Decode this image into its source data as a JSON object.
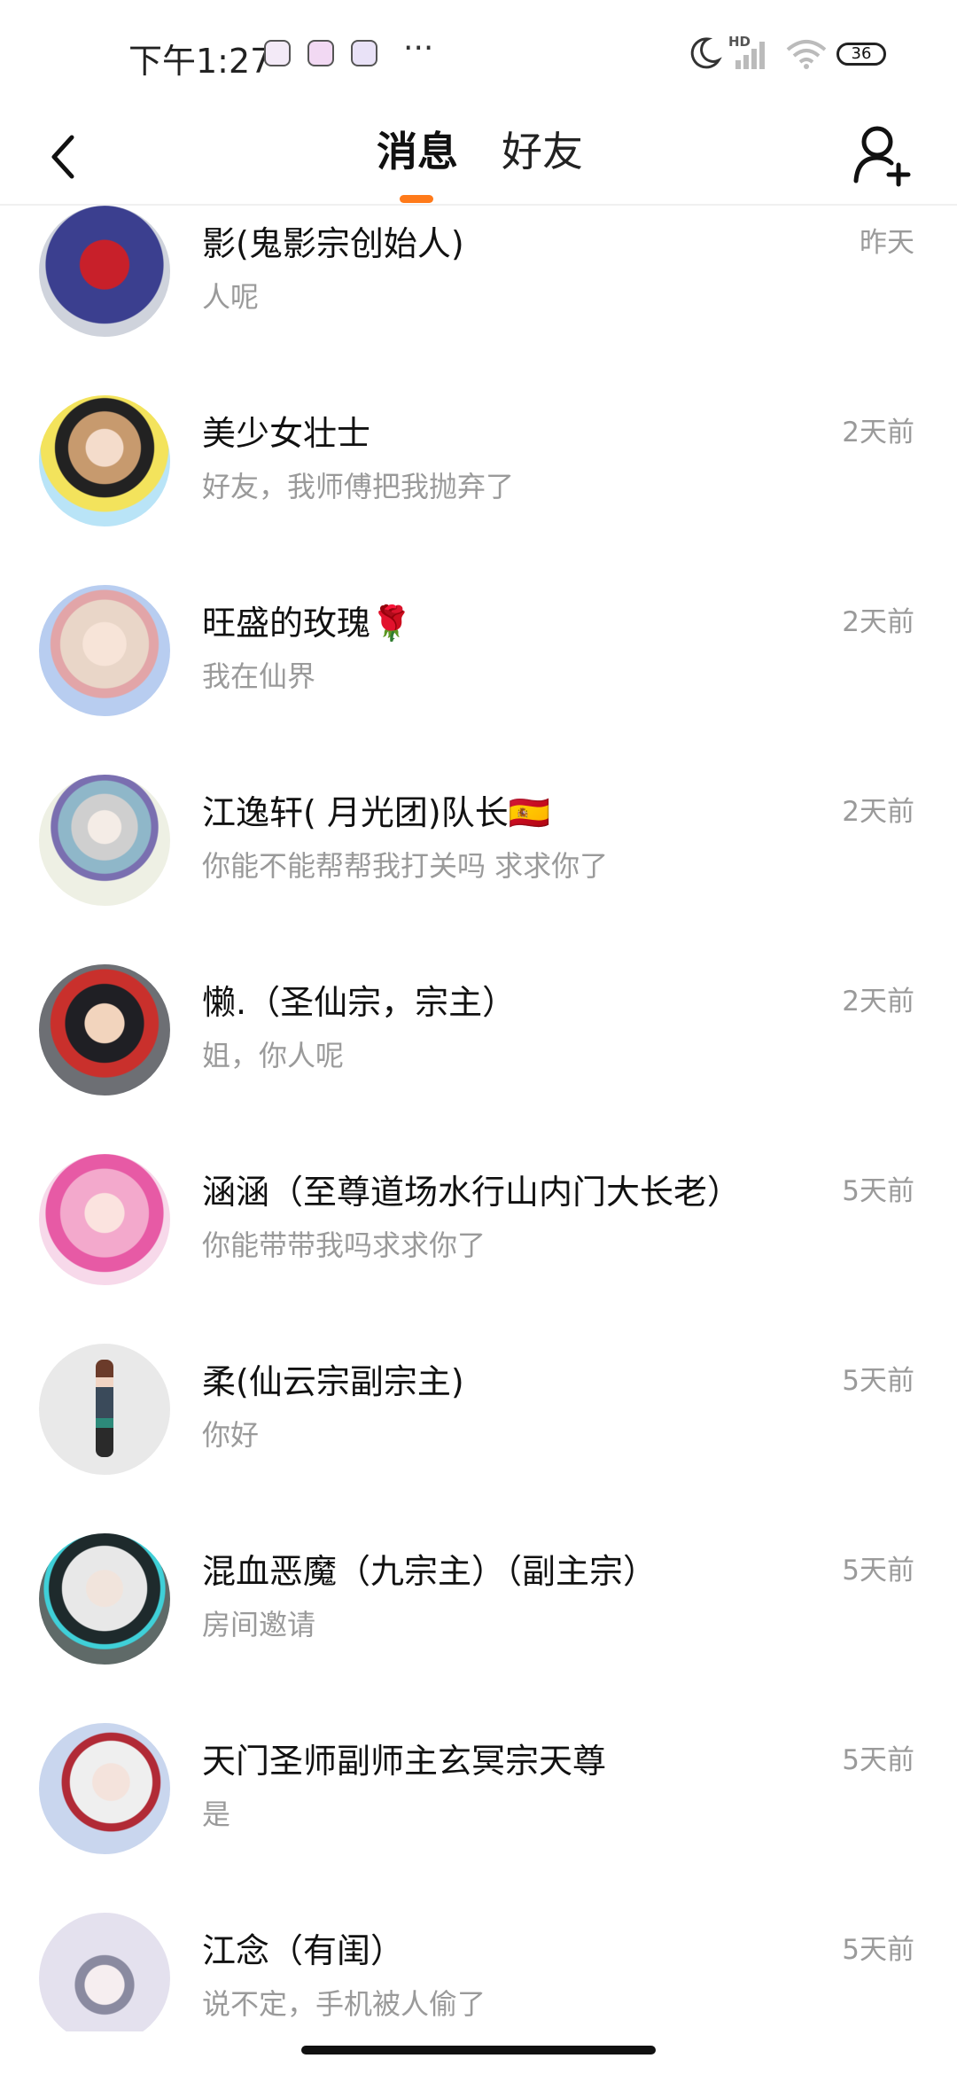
{
  "status_bar": {
    "time": "下午1:27",
    "more": "···",
    "network_label": "HD",
    "battery": "36"
  },
  "header": {
    "tabs": [
      {
        "label": "消息",
        "active": true
      },
      {
        "label": "好友",
        "active": false
      }
    ],
    "accent_color": "#ff7a1a"
  },
  "conversations": [
    {
      "name": "影(鬼影宗创始人)",
      "preview": "人呢",
      "time": "昨天",
      "avatar_colors": [
        "#3b3f8f",
        "#c8202a"
      ]
    },
    {
      "name": "美少女壮士",
      "preview": "好友，我师傅把我抛弃了",
      "time": "2天前",
      "avatar_colors": [
        "#b9e4f7",
        "#f3e35c"
      ]
    },
    {
      "name": "旺盛的玫瑰🌹",
      "preview": "我在仙界",
      "time": "2天前",
      "avatar_colors": [
        "#b8cdf0",
        "#e9d6c8"
      ]
    },
    {
      "name": "江逸轩( 月光团)队长🇪🇸",
      "preview": "你能不能帮帮我打关吗 求求你了",
      "time": "2天前",
      "avatar_colors": [
        "#eef0e4",
        "#8fb7c9"
      ]
    },
    {
      "name": "懒.（圣仙宗，宗主）",
      "preview": "姐，你人呢",
      "time": "2天前",
      "avatar_colors": [
        "#6d6f74",
        "#c9302c"
      ]
    },
    {
      "name": "涵涵（至尊道场水行山内门大长老）",
      "preview": "你能带带我吗求求你了",
      "time": "5天前",
      "avatar_colors": [
        "#f3a9cc",
        "#e75aa5"
      ]
    },
    {
      "name": "柔(仙云宗副宗主)",
      "preview": "你好",
      "time": "5天前",
      "avatar_colors": [
        "#e9e9e9",
        "#3a4a5a"
      ]
    },
    {
      "name": "混血恶魔（九宗主）（副主宗）",
      "preview": "房间邀请",
      "time": "5天前",
      "avatar_colors": [
        "#5f6a68",
        "#e8e8e8"
      ]
    },
    {
      "name": "天门圣师副师主玄冥宗天尊",
      "preview": "是",
      "time": "5天前",
      "avatar_colors": [
        "#c9d6ee",
        "#b12a36"
      ]
    },
    {
      "name": "江念（有闺）",
      "preview": "说不定，手机被人偷了",
      "time": "5天前",
      "avatar_colors": [
        "#e4e1ee",
        "#8a8aa0"
      ]
    }
  ]
}
